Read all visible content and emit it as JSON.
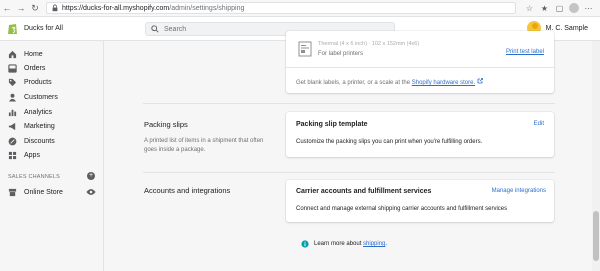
{
  "browser": {
    "url_host": "https://ducks-for-all.myshopify.com",
    "url_path": "/admin/settings/shipping"
  },
  "topbar": {
    "store_name": "Ducks for All",
    "search_placeholder": "Search",
    "user_name": "M. C. Sample"
  },
  "sidebar": {
    "items": [
      {
        "label": "Home",
        "icon": "home-icon"
      },
      {
        "label": "Orders",
        "icon": "orders-icon"
      },
      {
        "label": "Products",
        "icon": "tag-icon"
      },
      {
        "label": "Customers",
        "icon": "person-icon"
      },
      {
        "label": "Analytics",
        "icon": "bar-chart-icon"
      },
      {
        "label": "Marketing",
        "icon": "megaphone-icon"
      },
      {
        "label": "Discounts",
        "icon": "discount-icon"
      },
      {
        "label": "Apps",
        "icon": "apps-icon"
      }
    ],
    "channels_header": "SALES CHANNELS",
    "online_store": "Online Store"
  },
  "label_printer": {
    "partial_text": "Thermal (4 x 6 inch) · 102 x 152mm (4x6)",
    "sub": "For label printers",
    "print_test": "Print test label",
    "hardware_text_before": "Get blank labels, a printer, or a scale at the",
    "hardware_link": "Shopify hardware store."
  },
  "packing_slips": {
    "section_title": "Packing slips",
    "section_desc": "A printed list of items in a shipment that often goes inside a package.",
    "card_title": "Packing slip template",
    "edit_label": "Edit",
    "card_text": "Customize the packing slips you can print when you're fulfilling orders."
  },
  "accounts": {
    "section_title": "Accounts and integrations",
    "card_title": "Carrier accounts and fulfillment services",
    "manage_label": "Manage integrations",
    "card_text": "Connect and manage external shipping carrier accounts and fulfillment services"
  },
  "footer": {
    "learn_more": "Learn more about",
    "shipping_link": "shipping",
    "period": "."
  },
  "colors": {
    "accent_link": "#2c6ecb",
    "sidebar_bg": "#f6f6f7",
    "info_teal": "#00a0ac"
  }
}
